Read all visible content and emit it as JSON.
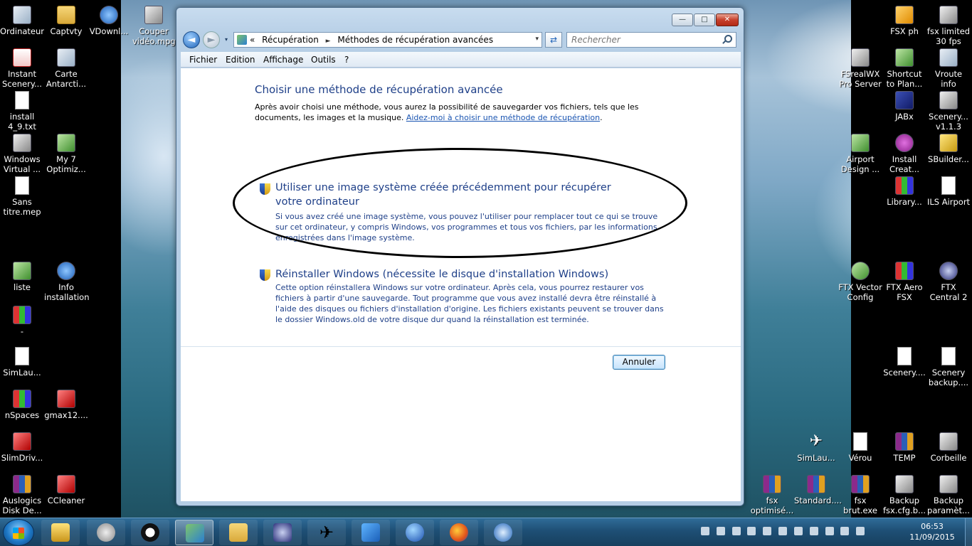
{
  "desktop": {
    "left_icons": [
      {
        "label": "Ordinateur",
        "icon": "computer-icon"
      },
      {
        "label": "Captvty",
        "icon": "folder-icon"
      },
      {
        "label": "VDownl...",
        "icon": "vdownloader-icon"
      },
      {
        "label": "Couper vidéo.mpg",
        "icon": "video-file-icon"
      },
      {
        "label": "Instant Scenery...",
        "icon": "pdf-icon"
      },
      {
        "label": "Carte Antarcti...",
        "icon": "image-file-icon"
      },
      {
        "label": "install 4_9.txt",
        "icon": "text-file-icon"
      },
      {
        "label": "Windows Virtual ...",
        "icon": "virtual-pc-icon"
      },
      {
        "label": "My 7 Optimiz...",
        "icon": "optimizer-icon"
      },
      {
        "label": "Sans titre.mep",
        "icon": "file-icon"
      },
      {
        "label": "liste",
        "icon": "excel-icon"
      },
      {
        "label": "Info installation",
        "icon": "info-icon"
      },
      {
        "label": "-",
        "icon": "app-icon"
      },
      {
        "label": "SimLau...",
        "icon": "file-icon"
      },
      {
        "label": "nSpaces",
        "icon": "nspaces-icon"
      },
      {
        "label": "gmax12....",
        "icon": "gmax-icon"
      },
      {
        "label": "SlimDriv...",
        "icon": "slimdrivers-icon"
      },
      {
        "label": "Auslogics Disk De...",
        "icon": "auslogics-icon"
      },
      {
        "label": "CCleaner",
        "icon": "ccleaner-icon"
      }
    ],
    "right_icons": [
      {
        "label": "FSX ph",
        "icon": "fsx-icon"
      },
      {
        "label": "fsx limited 30 fps",
        "icon": "shortcut-icon"
      },
      {
        "label": "FSrealWX Pro Server",
        "icon": "server-icon"
      },
      {
        "label": "Shortcut to Plan...",
        "icon": "planner-icon"
      },
      {
        "label": "Vroute info",
        "icon": "vroute-icon"
      },
      {
        "label": "JABx",
        "icon": "jab-icon"
      },
      {
        "label": "Scenery... v1.1.3",
        "icon": "scenery-icon"
      },
      {
        "label": "Airport Design ...",
        "icon": "airport-design-icon"
      },
      {
        "label": "Install Creat...",
        "icon": "install-creator-icon"
      },
      {
        "label": "SBuilder...",
        "icon": "sbuilder-icon"
      },
      {
        "label": "Library...",
        "icon": "library-icon"
      },
      {
        "label": "ILS Airport",
        "icon": "ils-airport-icon"
      },
      {
        "label": "FTX Vector Config",
        "icon": "ftx-vector-icon"
      },
      {
        "label": "FTX Aero FSX",
        "icon": "ftx-aero-icon"
      },
      {
        "label": "FTX Central 2",
        "icon": "ftx-central-icon"
      },
      {
        "label": "Scenery....",
        "icon": "file-icon"
      },
      {
        "label": "Scenery backup....",
        "icon": "file-icon"
      },
      {
        "label": "SimLau...",
        "icon": "plane-icon"
      },
      {
        "label": "Vérou",
        "icon": "file-icon"
      },
      {
        "label": "TEMP",
        "icon": "winrar-icon"
      },
      {
        "label": "Corbeille",
        "icon": "recycle-bin-icon"
      },
      {
        "label": "fsx optimisé...",
        "icon": "winrar-icon"
      },
      {
        "label": "Standard....",
        "icon": "winrar-icon"
      },
      {
        "label": "fsx brut.exe",
        "icon": "winrar-icon"
      },
      {
        "label": "Backup fsx.cfg.b...",
        "icon": "shortcut-icon"
      },
      {
        "label": "Backup paramèt...",
        "icon": "shortcut-icon"
      }
    ]
  },
  "window": {
    "controls": {
      "minimize": "—",
      "maximize": "□",
      "close": "✕"
    },
    "nav": {
      "back": "◄",
      "forward": "►",
      "history": "▾"
    },
    "address": {
      "prefix": "«",
      "crumbs": [
        "Récupération",
        "Méthodes de récupération avancées"
      ],
      "separator": "►",
      "dropdown": "▾"
    },
    "refresh": "⇄",
    "search_placeholder": "Rechercher",
    "menu": [
      "Fichier",
      "Edition",
      "Affichage",
      "Outils",
      "?"
    ],
    "content": {
      "title": "Choisir une méthode de récupération avancée",
      "description": "Après avoir choisi une méthode, vous aurez la possibilité de sauvegarder vos fichiers, tels que les documents, les images et la musique.",
      "help_link": "Aidez-moi à choisir une méthode de récupération",
      "help_suffix": ".",
      "options": [
        {
          "title": "Utiliser une image système créée précédemment pour récupérer votre ordinateur",
          "description": "Si vous avez créé une image système, vous pouvez l'utiliser pour remplacer tout ce qui se trouve sur cet ordinateur, y compris Windows, vos programmes et tous vos fichiers, par les informations enregistrées dans l'image système."
        },
        {
          "title": "Réinstaller Windows (nécessite le disque d'installation Windows)",
          "description": "Cette option réinstallera Windows sur votre ordinateur. Après cela, vous pourrez restaurer vos fichiers à partir d'une sauvegarde. Tout programme que vous avez installé devra être réinstallé à l'aide des disques ou fichiers d'installation d'origine. Les fichiers existants peuvent se trouver dans le dossier Windows.old de votre disque dur quand la réinstallation est terminée."
        }
      ],
      "cancel_button": "Annuler"
    }
  },
  "taskbar": {
    "items": [
      {
        "name": "lock-icon",
        "state": "pinned"
      },
      {
        "name": "backup-icon",
        "state": "pinned"
      },
      {
        "name": "media-player-icon",
        "state": "pinned"
      },
      {
        "name": "control-panel-icon",
        "state": "active"
      },
      {
        "name": "explorer-icon",
        "state": "pinned"
      },
      {
        "name": "ftx-central-icon",
        "state": "pinned"
      },
      {
        "name": "plane-icon",
        "state": "pinned"
      },
      {
        "name": "fsx-icon",
        "state": "pinned"
      },
      {
        "name": "google-earth-icon",
        "state": "pinned"
      },
      {
        "name": "firefox-icon",
        "state": "pinned"
      },
      {
        "name": "browser-icon",
        "state": "pinned"
      }
    ],
    "clock": {
      "time": "06:53",
      "date": "11/09/2015"
    }
  },
  "colors": {
    "link": "#1a55b2",
    "heading": "#1e3f88",
    "taskbar": "#1e4f75",
    "window_frame": "#b7cfe6",
    "annotation_ellipse": "#000000"
  }
}
